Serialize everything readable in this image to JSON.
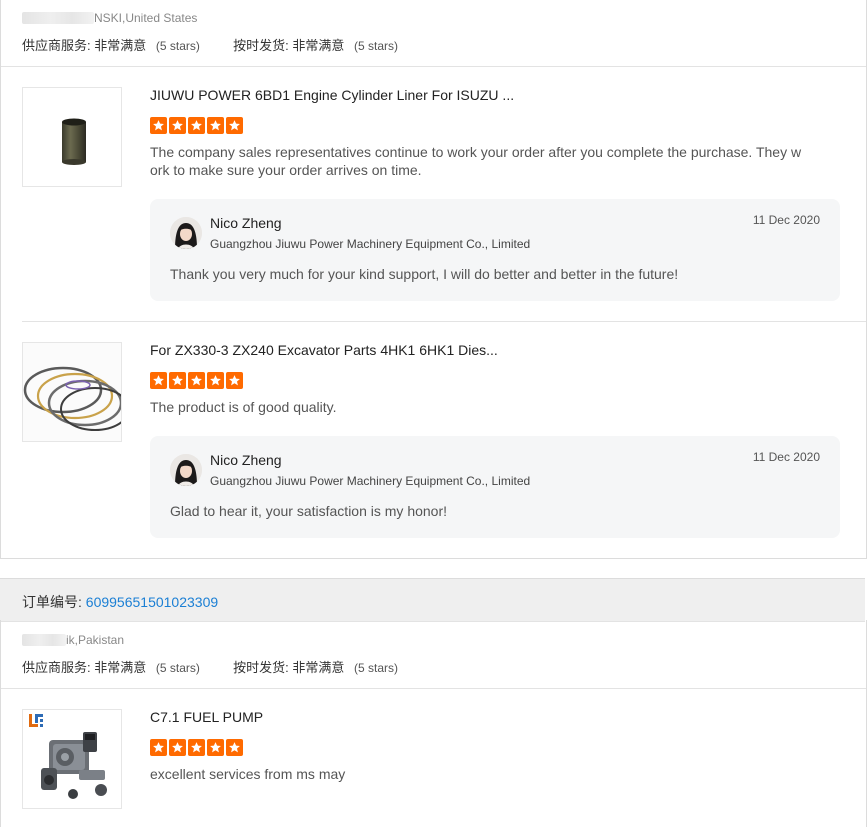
{
  "review1": {
    "buyer_suffix": "NSKI,United States",
    "supplier_service_label": "供应商服务:",
    "supplier_service_value": "非常满意",
    "supplier_service_stars": "(5 stars)",
    "ontime_label": "按时发货:",
    "ontime_value": "非常满意",
    "ontime_stars": "(5 stars)",
    "items": [
      {
        "title": "JIUWU POWER 6BD1 Engine Cylinder Liner For ISUZU ...",
        "rating": 5,
        "text": "The company sales representatives continue to work your order after you complete the purchase. They work to make sure your order arrives on time.",
        "reply": {
          "name": "Nico Zheng",
          "company": "Guangzhou Jiuwu Power Machinery Equipment Co., Limited",
          "date": "11 Dec 2020",
          "text": "Thank you very much for your kind support, I will do better and better in  the future!"
        }
      },
      {
        "title": "For ZX330-3 ZX240 Excavator Parts 4HK1 6HK1 Dies...",
        "rating": 5,
        "text": "The product is of good quality.",
        "reply": {
          "name": "Nico Zheng",
          "company": "Guangzhou Jiuwu Power Machinery Equipment Co., Limited",
          "date": "11 Dec 2020",
          "text": "Glad to hear it, your satisfaction is my honor!"
        }
      }
    ]
  },
  "order2": {
    "label": "订单编号:",
    "number": "60995651501023309"
  },
  "review2": {
    "buyer_suffix": "ik,Pakistan",
    "supplier_service_label": "供应商服务:",
    "supplier_service_value": "非常满意",
    "supplier_service_stars": "(5 stars)",
    "ontime_label": "按时发货:",
    "ontime_value": "非常满意",
    "ontime_stars": "(5 stars)",
    "items": [
      {
        "title": "C7.1 FUEL PUMP",
        "rating": 5,
        "text": "excellent services from ms may"
      }
    ]
  },
  "colors": {
    "star": "#ff6a00",
    "link": "#1b7fd4"
  },
  "icons": {
    "star": "star-icon",
    "avatar": "avatar"
  }
}
